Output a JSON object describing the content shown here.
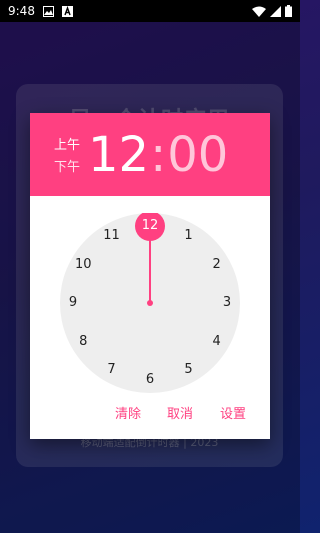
{
  "status_bar": {
    "time": "9:48",
    "left_icons": [
      "gallery-icon",
      "a-badge-icon"
    ],
    "right_icons": [
      "wifi-icon",
      "signal-icon",
      "battery-icon"
    ]
  },
  "background": {
    "title": "另一个计时应用",
    "footer": "移动端适配倒计时器 | 2023"
  },
  "dialog": {
    "am_label": "上午",
    "pm_label": "下午",
    "hour": "12",
    "colon": ":",
    "minute": "00",
    "clock_numbers": [
      "12",
      "1",
      "2",
      "3",
      "4",
      "5",
      "6",
      "7",
      "8",
      "9",
      "10",
      "11"
    ],
    "selected_hour": "12",
    "buttons": {
      "clear": "清除",
      "cancel": "取消",
      "set": "设置"
    },
    "accent_color": "#ff4081"
  }
}
